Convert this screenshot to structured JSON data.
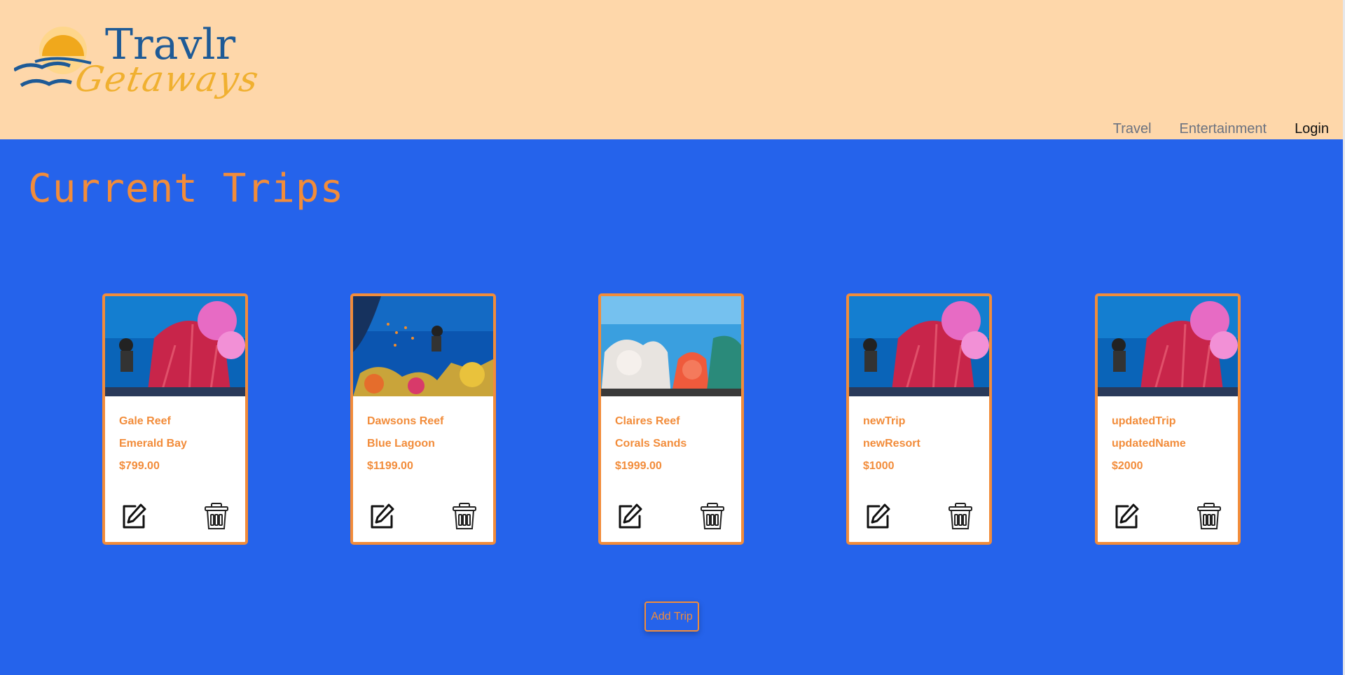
{
  "header": {
    "logo_line1": "Travlr",
    "logo_line2": "Getaways",
    "nav": [
      {
        "label": "Travel"
      },
      {
        "label": "Entertainment"
      },
      {
        "label": "Login"
      }
    ]
  },
  "main": {
    "title": "Current Trips",
    "add_button_label": "Add Trip",
    "trips": [
      {
        "name": "Gale Reef",
        "resort": "Emerald Bay",
        "price": "$799.00",
        "image": "gale-reef-photo"
      },
      {
        "name": "Dawsons Reef",
        "resort": "Blue Lagoon",
        "price": "$1199.00",
        "image": "dawsons-reef-photo"
      },
      {
        "name": "Claires Reef",
        "resort": "Corals Sands",
        "price": "$1999.00",
        "image": "claires-reef-photo"
      },
      {
        "name": "newTrip",
        "resort": "newResort",
        "price": "$1000",
        "image": "gale-reef-photo"
      },
      {
        "name": "updatedTrip",
        "resort": "updatedName",
        "price": "$2000",
        "image": "gale-reef-photo"
      }
    ]
  },
  "colors": {
    "header_bg": "#fed7aa",
    "page_bg": "#2563eb",
    "accent": "#f28c3a"
  },
  "icons": {
    "edit": "edit-icon",
    "delete": "trash-icon"
  }
}
